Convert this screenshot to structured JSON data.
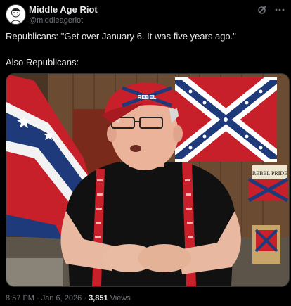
{
  "author": {
    "display_name": "Middle Age Riot",
    "handle": "@middleageriot"
  },
  "post": {
    "line1": "Republicans: \"Get over January 6. It was five years ago.\"",
    "line2": "Also Republicans:",
    "time": "8:57 PM",
    "separator": "·",
    "date": "Jan 6, 2026",
    "views_count": "3,851",
    "views_label": "Views"
  },
  "image": {
    "sign_text": "REBEL PRIDE",
    "hat_text": "REBEL"
  },
  "icons": {
    "grok": "grok-icon",
    "more": "more-icon"
  },
  "colors": {
    "background": "#000000",
    "text": "#e7e9ea",
    "secondary": "#71767b",
    "flag_red": "#c8202a",
    "flag_blue": "#1f3a7a"
  }
}
